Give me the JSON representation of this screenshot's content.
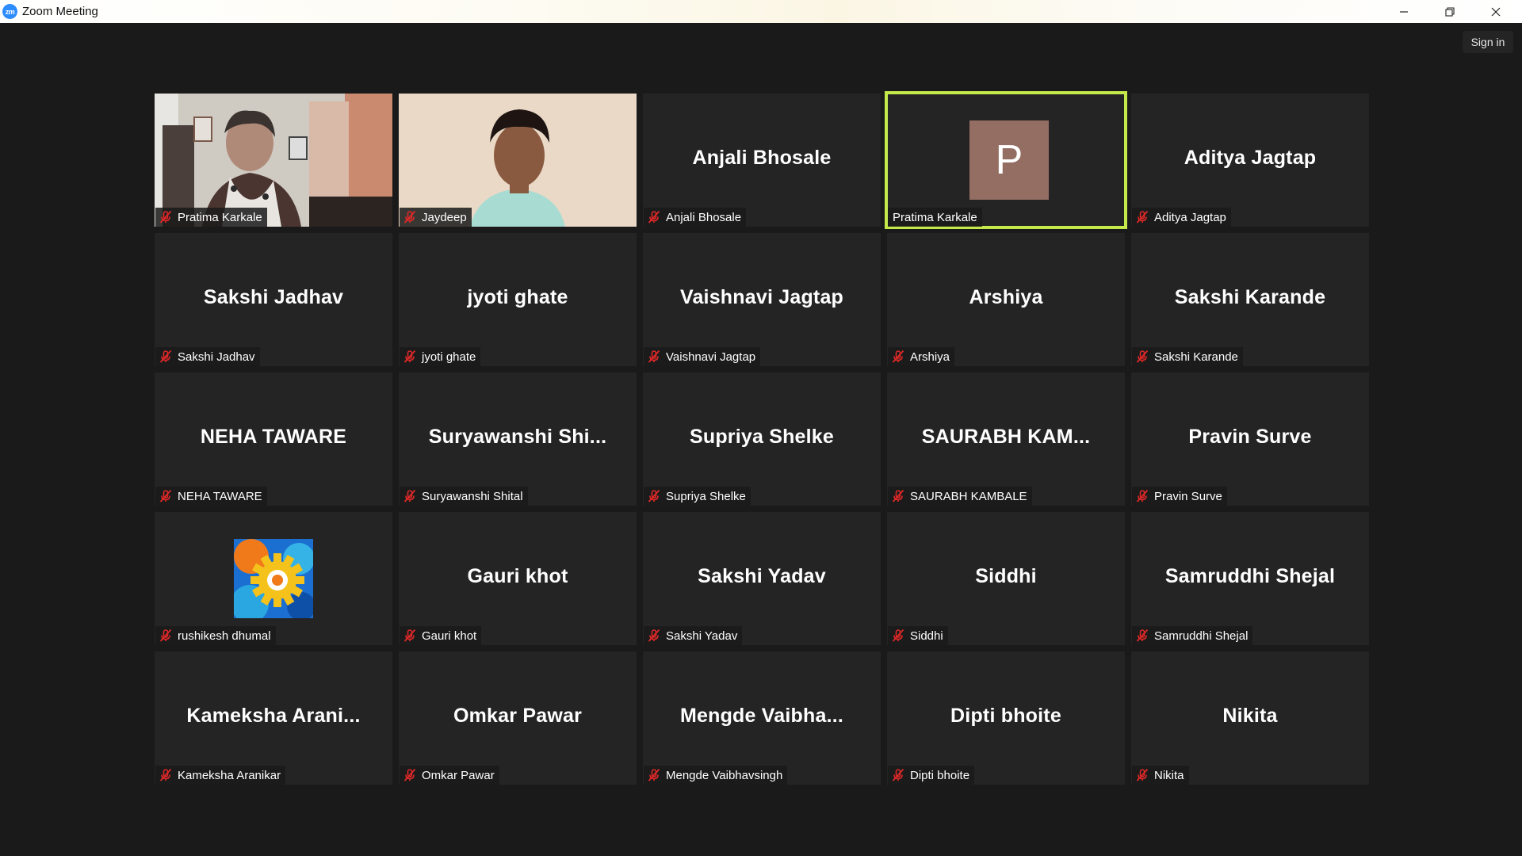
{
  "window": {
    "title": "Zoom Meeting",
    "app_icon_text": "zm",
    "minimize_icon": "minimize-icon",
    "maximize_icon": "restore-icon",
    "close_icon": "close-icon"
  },
  "header": {
    "sign_in_label": "Sign in"
  },
  "colors": {
    "background": "#1a1a1a",
    "tile": "#242424",
    "active_speaker_border": "#c5e84b",
    "mute_icon": "#e02828",
    "avatar_p": "#946d63"
  },
  "participants": [
    {
      "display": "",
      "label": "Pratima Karkale",
      "type": "video",
      "muted": true
    },
    {
      "display": "",
      "label": "Jaydeep",
      "type": "video",
      "muted": true
    },
    {
      "display": "Anjali Bhosale",
      "label": "Anjali Bhosale",
      "type": "name",
      "muted": true
    },
    {
      "display": "P",
      "label": "Pratima Karkale",
      "type": "avatar",
      "muted": false,
      "active": true
    },
    {
      "display": "Aditya Jagtap",
      "label": "Aditya Jagtap",
      "type": "name",
      "muted": true
    },
    {
      "display": "Sakshi Jadhav",
      "label": "Sakshi Jadhav",
      "type": "name",
      "muted": true
    },
    {
      "display": "jyoti ghate",
      "label": "jyoti ghate",
      "type": "name",
      "muted": true
    },
    {
      "display": "Vaishnavi Jagtap",
      "label": "Vaishnavi Jagtap",
      "type": "name",
      "muted": true
    },
    {
      "display": "Arshiya",
      "label": "Arshiya",
      "type": "name",
      "muted": true
    },
    {
      "display": "Sakshi Karande",
      "label": "Sakshi Karande",
      "type": "name",
      "muted": true
    },
    {
      "display": "NEHA TAWARE",
      "label": "NEHA TAWARE",
      "type": "name",
      "muted": true
    },
    {
      "display": "Suryawanshi  Shi...",
      "label": "Suryawanshi Shital",
      "type": "name",
      "muted": true
    },
    {
      "display": "Supriya Shelke",
      "label": "Supriya Shelke",
      "type": "name",
      "muted": true
    },
    {
      "display": "SAURABH  KAM...",
      "label": "SAURABH KAMBALE",
      "type": "name",
      "muted": true
    },
    {
      "display": "Pravin Surve",
      "label": "Pravin Surve",
      "type": "name",
      "muted": true
    },
    {
      "display": "",
      "label": "rushikesh dhumal",
      "type": "image",
      "muted": true
    },
    {
      "display": "Gauri  khot",
      "label": "Gauri  khot",
      "type": "name",
      "muted": true
    },
    {
      "display": "Sakshi Yadav",
      "label": "Sakshi Yadav",
      "type": "name",
      "muted": true
    },
    {
      "display": "Siddhi",
      "label": "Siddhi",
      "type": "name",
      "muted": true
    },
    {
      "display": "Samruddhi Shejal",
      "label": "Samruddhi Shejal",
      "type": "name",
      "muted": true
    },
    {
      "display": "Kameksha  Arani...",
      "label": "Kameksha Aranikar",
      "type": "name",
      "muted": true
    },
    {
      "display": "Omkar Pawar",
      "label": "Omkar Pawar",
      "type": "name",
      "muted": true
    },
    {
      "display": "Mengde  Vaibha...",
      "label": "Mengde Vaibhavsingh",
      "type": "name",
      "muted": true
    },
    {
      "display": "Dipti bhoite",
      "label": "Dipti bhoite",
      "type": "name",
      "muted": true
    },
    {
      "display": "Nikita",
      "label": "Nikita",
      "type": "name",
      "muted": true
    }
  ]
}
